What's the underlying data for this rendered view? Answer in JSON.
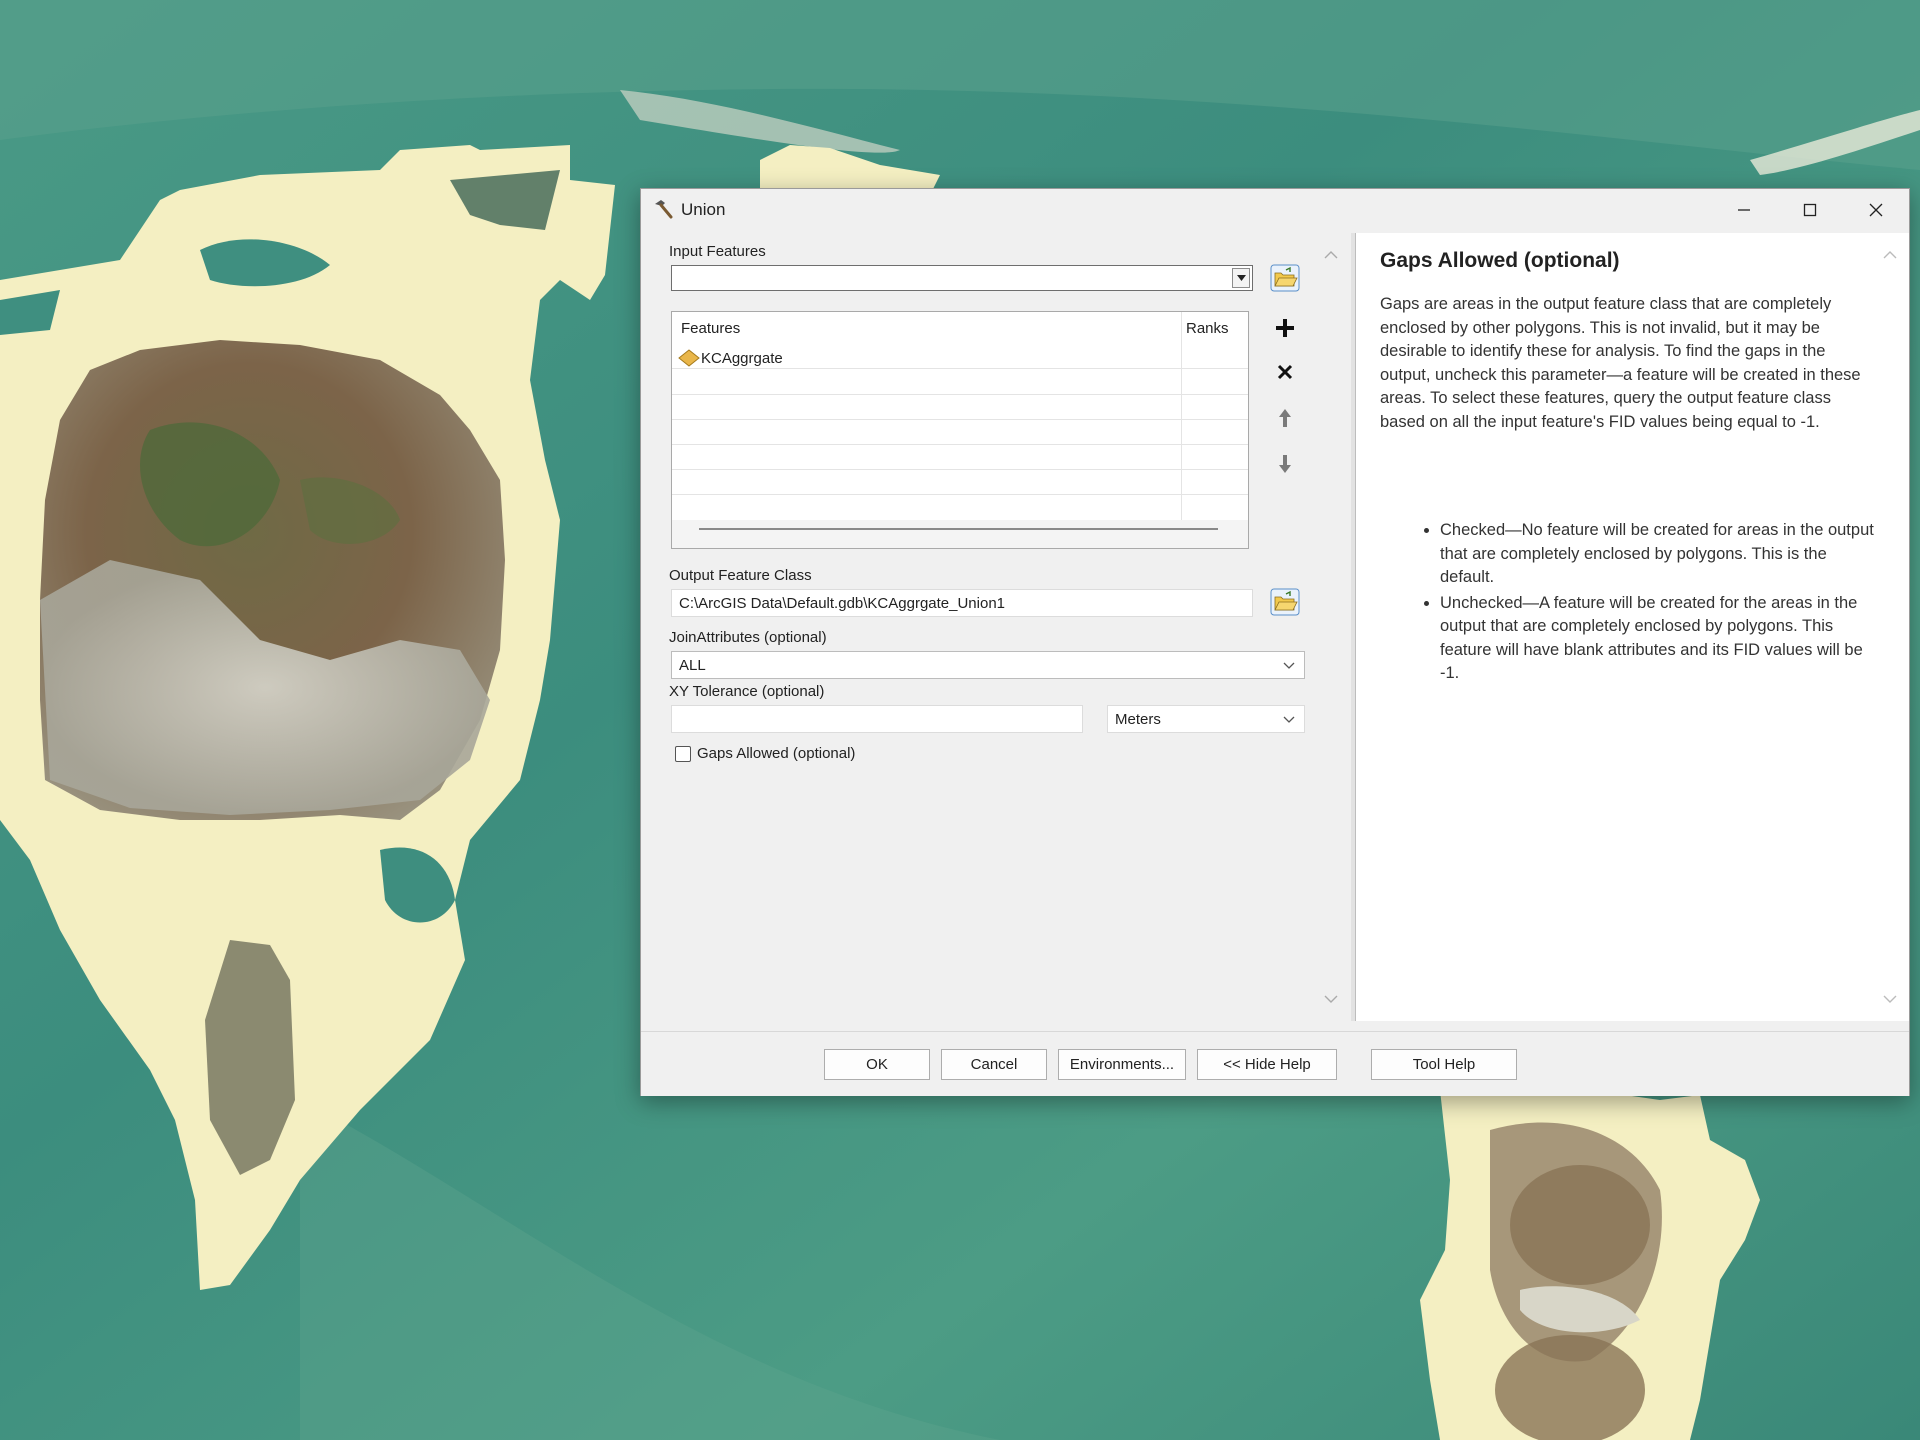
{
  "window": {
    "title": "Union"
  },
  "form": {
    "input_features_label": "Input Features",
    "input_features_value": "",
    "table": {
      "col_features": "Features",
      "col_ranks": "Ranks",
      "rows": [
        {
          "feature": "KCAggrgate",
          "rank": ""
        }
      ]
    },
    "output_label": "Output Feature Class",
    "output_value": "C:\\ArcGIS Data\\Default.gdb\\KCAggrgate_Union1",
    "join_label": "JoinAttributes (optional)",
    "join_value": "ALL",
    "xy_label": "XY Tolerance (optional)",
    "xy_value": "",
    "xy_unit": "Meters",
    "gaps_label": "Gaps Allowed (optional)",
    "gaps_checked": false
  },
  "help": {
    "title": "Gaps Allowed (optional)",
    "paragraph": "Gaps are areas in the output feature class that are completely enclosed by other polygons. This is not invalid, but it may be desirable to identify these for analysis. To find the gaps in the output, uncheck this parameter—a feature will be created in these areas. To select these features, query the output feature class based on all the input feature's FID values being equal to -1.",
    "bullets": [
      "Checked—No feature will be created for areas in the output that are completely enclosed by polygons. This is the default.",
      "Unchecked—A feature will be created for the areas in the output that are completely enclosed by polygons. This feature will have blank attributes and its FID values will be -1."
    ]
  },
  "buttons": {
    "ok": "OK",
    "cancel": "Cancel",
    "environments": "Environments...",
    "hide_help": "<< Hide Help",
    "tool_help": "Tool Help"
  },
  "icons": {
    "window": "hammer-icon",
    "browse": "folder-open-icon",
    "add": "plus-icon",
    "remove": "x-icon",
    "up": "arrow-up-icon",
    "down": "arrow-down-icon",
    "feature": "polygon-layer-icon"
  },
  "colors": {
    "water": "#3f9080",
    "polygon_fill": "#f5f0c3",
    "dialog_bg": "#f0f0f0",
    "folder_yellow": "#f2c94c"
  }
}
